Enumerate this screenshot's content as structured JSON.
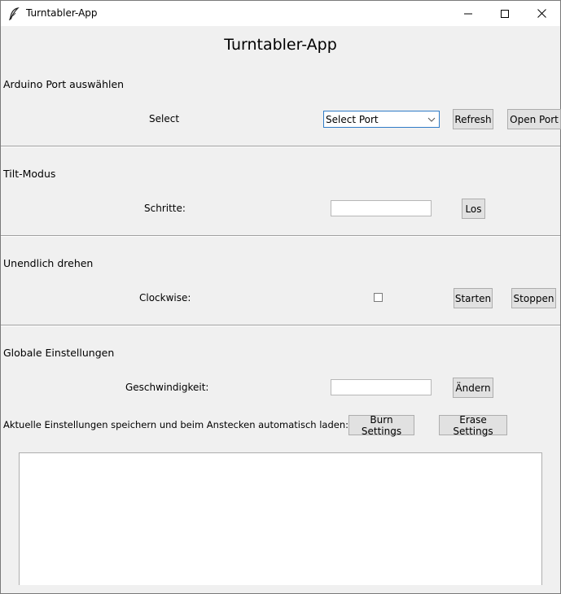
{
  "window": {
    "title": "Turntabler-App",
    "icon": "feather-icon",
    "controls": [
      "minimize-icon",
      "maximize-icon",
      "close-icon"
    ]
  },
  "app": {
    "heading": "Turntabler-App"
  },
  "port_section": {
    "title": "Arduino Port auswählen",
    "select_label": "Select",
    "combo_value": "Select Port",
    "refresh_label": "Refresh",
    "open_label": "Open Port"
  },
  "tilt_section": {
    "title": "Tilt-Modus",
    "steps_label": "Schritte:",
    "steps_value": "",
    "go_label": "Los"
  },
  "spin_section": {
    "title": "Unendlich drehen",
    "clockwise_label": "Clockwise:",
    "clockwise_checked": false,
    "start_label": "Starten",
    "stop_label": "Stoppen"
  },
  "global_section": {
    "title": "Globale Einstellungen",
    "speed_label": "Geschwindigkeit:",
    "speed_value": "",
    "change_label": "Ändern",
    "save_text": "Aktuelle Einstellungen speichern und beim Anstecken automatisch laden:",
    "burn_label": "Burn Settings",
    "erase_label": "Erase Settings"
  },
  "log": {
    "content": ""
  }
}
